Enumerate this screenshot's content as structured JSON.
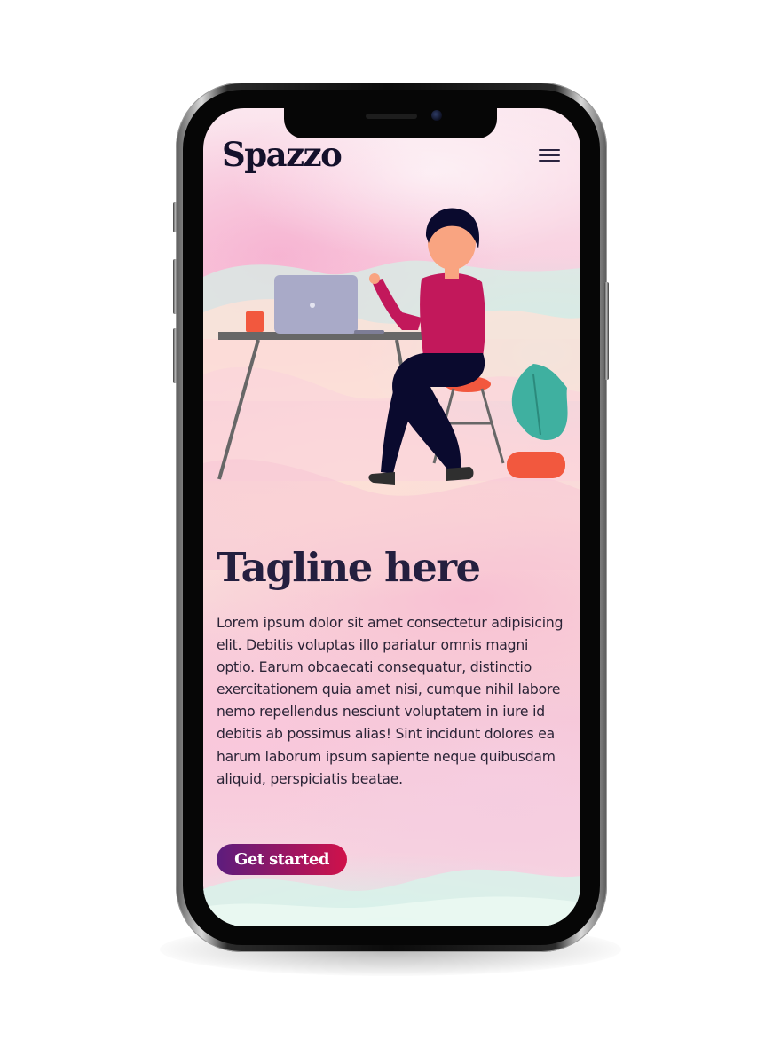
{
  "app": {
    "brand": "Spazzo",
    "menu_icon": "hamburger-menu-icon"
  },
  "hero": {
    "illustration": "person-at-desk-with-laptop-illustration",
    "tagline": "Tagline here",
    "body": "Lorem ipsum dolor sit amet consectetur adipisicing elit. Debitis voluptas illo pariatur omnis magni optio. Earum obcaecati consequatur, distinctio exercitationem quia amet nisi, cumque nihil labore nemo repellendus nesciunt voluptatem in iure id debitis ab possimus alias! Sint incidunt dolores ea harum laborum ipsum sapiente neque quibusdam aliquid, perspiciatis beatae.",
    "cta_label": "Get started"
  },
  "colors": {
    "brand_text": "#14112b",
    "heading": "#241f3f",
    "cta_gradient_start": "#5c1d7d",
    "cta_gradient_end": "#d0124a",
    "shirt": "#c2185b",
    "pants": "#0a0a2e",
    "laptop": "#a9aac8",
    "plant": "#3fb0a0",
    "pot": "#f2583e"
  }
}
